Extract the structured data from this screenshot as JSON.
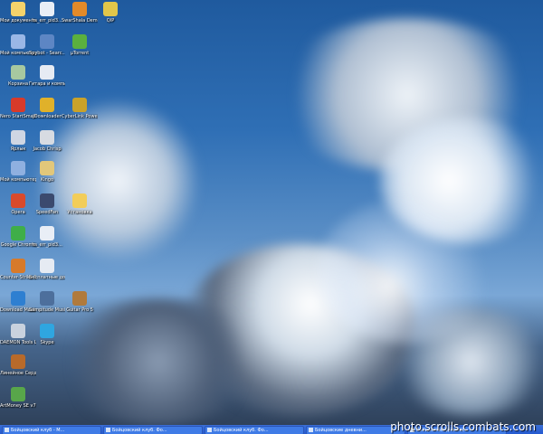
{
  "desktop": {
    "icons": [
      {
        "label": "Мои документы",
        "icon": "folder-icon",
        "color": "#f5d36b"
      },
      {
        "label": "Мой компьютер",
        "icon": "computer-icon",
        "color": "#9ab7e6"
      },
      {
        "label": "Корзина",
        "icon": "trash-icon",
        "color": "#a7c8a0"
      },
      {
        "label": "Nero StartSmart",
        "icon": "nero-icon",
        "color": "#d83a2a"
      },
      {
        "label": "Ярлык",
        "icon": "shortcut-icon",
        "color": "#cfd6e3"
      },
      {
        "label": "Мой компьютер",
        "icon": "computer-icon",
        "color": "#8fb0e0"
      },
      {
        "label": "Opera",
        "icon": "opera-icon",
        "color": "#d94a2c"
      },
      {
        "label": "Google Chrome",
        "icon": "chrome-icon",
        "color": "#3fae49"
      },
      {
        "label": "Counter-Strike 1.6 RCM",
        "icon": "game-icon",
        "color": "#d77a2a"
      },
      {
        "label": "Download Master",
        "icon": "download-icon",
        "color": "#2e7fd1"
      },
      {
        "label": "DAEMON Tools Lite",
        "icon": "daemon-icon",
        "color": "#c9d2de"
      },
      {
        "label": "Линейное Сердце",
        "icon": "app-icon",
        "color": "#b86a2a"
      },
      {
        "label": "ArtMoney SE v7.33",
        "icon": "money-icon",
        "color": "#58a64a"
      },
      {
        "label": "hs_err_pid3...",
        "icon": "file-icon",
        "color": "#e9eef6"
      },
      {
        "label": "Spybot - Searc...",
        "icon": "spybot-icon",
        "color": "#5d86c4"
      },
      {
        "label": "Гитара и компьют...",
        "icon": "doc-icon",
        "color": "#e6ebf3"
      },
      {
        "label": "JDownloader",
        "icon": "download-icon",
        "color": "#e0b12a"
      },
      {
        "label": "Jacob Chrisp",
        "icon": "music-icon",
        "color": "#d7dbe2"
      },
      {
        "label": "Kingo",
        "icon": "app-icon",
        "color": "#e2c77a"
      },
      {
        "label": "SpeedFan",
        "icon": "fan-icon",
        "color": "#3b4a6e"
      },
      {
        "label": "hs_err_pid3...",
        "icon": "file-icon",
        "color": "#e9eef6"
      },
      {
        "label": "Бесплатные документы",
        "icon": "doc-icon",
        "color": "#e6ebf3"
      },
      {
        "label": "Sampitude Music Stu...",
        "icon": "music-icon",
        "color": "#4d6f9c"
      },
      {
        "label": "Skype",
        "icon": "skype-icon",
        "color": "#2fa6e0"
      },
      {
        "label": "SwarShala Demo",
        "icon": "app-icon",
        "color": "#e28a2a"
      },
      {
        "label": "µTorrent",
        "icon": "torrent-icon",
        "color": "#5bb03e"
      },
      {
        "label": "CyberLink PowerDVD 9",
        "icon": "dvd-icon",
        "color": "#c9a22a"
      },
      {
        "label": "Установка",
        "icon": "folder-icon",
        "color": "#f2cd59"
      },
      {
        "label": "Guitar Pro 5",
        "icon": "guitar-icon",
        "color": "#b07a3c"
      },
      {
        "label": "QIP",
        "icon": "qip-icon",
        "color": "#e1c64a"
      }
    ]
  },
  "taskbar": {
    "tasks": [
      {
        "label": "Бойцовский клуб - М..."
      },
      {
        "label": "Бойцовский клуб. Фо..."
      },
      {
        "label": "Бойцовский клуб. Фо..."
      },
      {
        "label": "Бойцовские дневни..."
      },
      {
        "label": "Бойцовские дневни..."
      }
    ]
  },
  "watermark": "photo.scrolls.combats.com"
}
